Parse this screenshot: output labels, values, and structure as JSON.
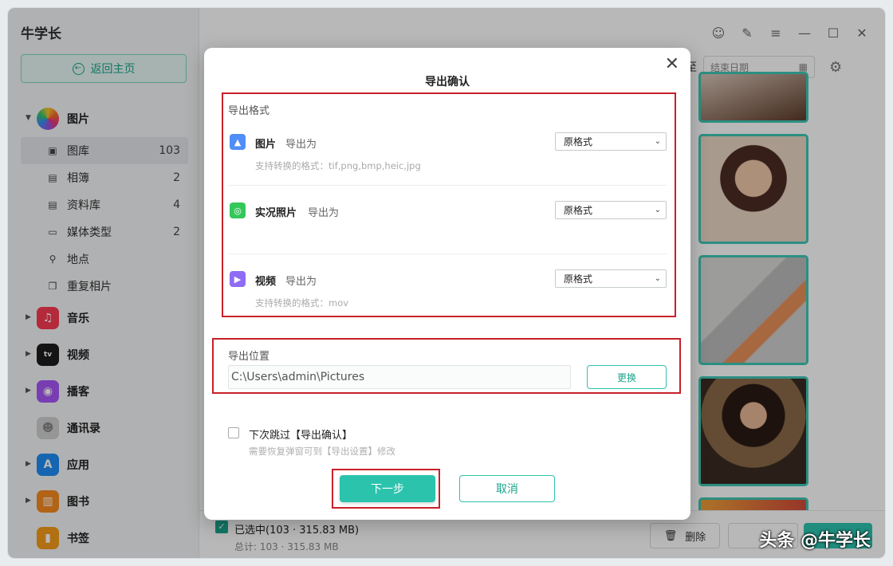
{
  "app": {
    "title": "牛学长",
    "home_button": "返回主页"
  },
  "sidebar": {
    "photos": {
      "label": "图片"
    },
    "photo_sub": [
      {
        "label": "图库",
        "count": "103",
        "icon": "image-icon"
      },
      {
        "label": "相簿",
        "count": "2",
        "icon": "album-icon"
      },
      {
        "label": "资料库",
        "count": "4",
        "icon": "library-icon"
      },
      {
        "label": "媒体类型",
        "count": "2",
        "icon": "video-icon"
      },
      {
        "label": "地点",
        "count": "",
        "icon": "location-icon"
      },
      {
        "label": "重复相片",
        "count": "",
        "icon": "duplicate-icon"
      }
    ],
    "categories": [
      {
        "label": "音乐",
        "color": "#fa3b53",
        "icon": "music-icon"
      },
      {
        "label": "视频",
        "color": "#1c1c1e",
        "icon": "tv-icon"
      },
      {
        "label": "播客",
        "color": "#a855f7",
        "icon": "podcast-icon"
      },
      {
        "label": "通讯录",
        "color": "#c9c9c9",
        "icon": "contacts-icon"
      },
      {
        "label": "应用",
        "color": "#1e8cf5",
        "icon": "appstore-icon"
      },
      {
        "label": "图书",
        "color": "#f58a1f",
        "icon": "books-icon"
      },
      {
        "label": "书签",
        "color": "#f59c1a",
        "icon": "bookmark-icon"
      }
    ]
  },
  "toolbar": {
    "to_label": "至",
    "end_date_placeholder": "结束日期"
  },
  "bottom": {
    "selected": "已选中(103 · 315.83 MB)",
    "total": "总计: 103 · 315.83 MB",
    "delete_label": "删除"
  },
  "dialog": {
    "title": "导出确认",
    "format_section": "导出格式",
    "rows": [
      {
        "title": "图片",
        "sub": "导出为",
        "select": "原格式",
        "hint": "支持转换的格式：tif,png,bmp,heic,jpg",
        "color": "#4f8ef7"
      },
      {
        "title": "实况照片",
        "sub": "导出为",
        "select": "原格式",
        "hint": "",
        "color": "#34c759"
      },
      {
        "title": "视频",
        "sub": "导出为",
        "select": "原格式",
        "hint": "支持转换的格式：mov",
        "color": "#8e6cf5"
      }
    ],
    "location_section": "导出位置",
    "path": "C:\\Users\\admin\\Pictures",
    "change_label": "更换",
    "skip_label": "下次跳过【导出确认】",
    "skip_hint": "需要恢复弹窗可到【导出设置】修改",
    "next_label": "下一步",
    "cancel_label": "取消"
  },
  "watermark": "头条 @牛学长"
}
